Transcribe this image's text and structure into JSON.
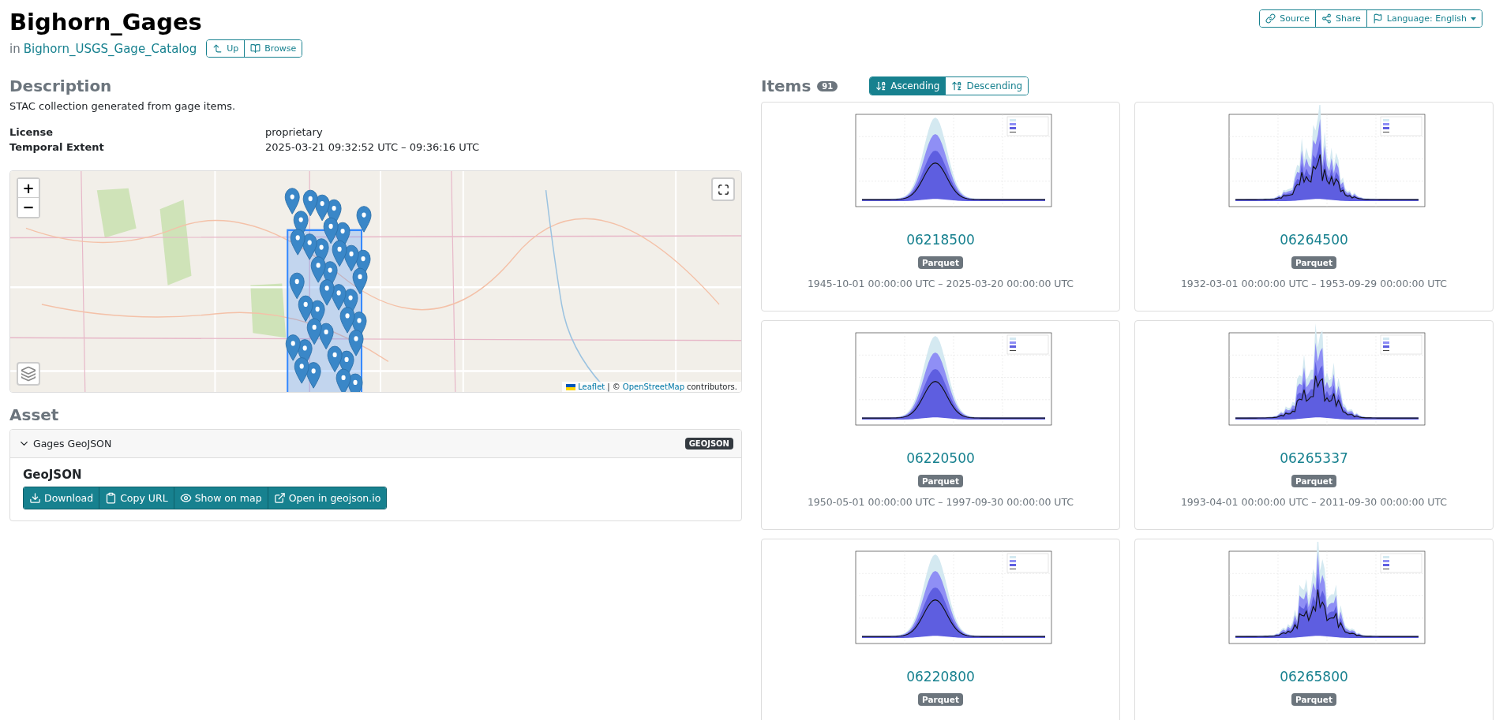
{
  "header": {
    "title": "Bighorn_Gages",
    "parent_prefix": "in",
    "parent_link": "Bighorn_USGS_Gage_Catalog",
    "nav_buttons": [
      {
        "kind": "up",
        "label": "Up"
      },
      {
        "kind": "browse",
        "label": "Browse"
      }
    ],
    "actions": [
      {
        "kind": "source",
        "label": "Source"
      },
      {
        "kind": "share",
        "label": "Share"
      },
      {
        "kind": "language",
        "label": "Language: English"
      }
    ]
  },
  "description": {
    "heading": "Description",
    "text": "STAC collection generated from gage items.",
    "metadata": [
      {
        "label": "License",
        "value": "proprietary"
      },
      {
        "label": "Temporal Extent",
        "value": "2025-03-21 09:32:52 UTC – 09:36:16 UTC"
      }
    ]
  },
  "map": {
    "zoom_in": "+",
    "zoom_out": "−",
    "attribution": {
      "leaflet": "Leaflet",
      "separator": "| ©",
      "osm": "OpenStreetMap",
      "suffix": "contributors."
    }
  },
  "asset": {
    "heading": "Asset",
    "title": "Gages GeoJSON",
    "expanded": true,
    "badge": "GEOJSON",
    "name": "GeoJSON",
    "buttons": [
      {
        "kind": "download",
        "label": "Download"
      },
      {
        "kind": "copy",
        "label": "Copy URL"
      },
      {
        "kind": "map",
        "label": "Show on map"
      },
      {
        "kind": "external",
        "label": "Open in geojson.io"
      }
    ]
  },
  "items": {
    "heading": "Items",
    "count": "91",
    "sort": [
      {
        "kind": "asc",
        "label": "Ascending",
        "selected": true
      },
      {
        "kind": "desc",
        "label": "Descending",
        "selected": false
      }
    ],
    "cards": [
      {
        "id": "06218500",
        "badge": "Parquet",
        "datetime": "1945-10-01 00:00:00 UTC – 2025-03-20 00:00:00 UTC"
      },
      {
        "id": "06264500",
        "badge": "Parquet",
        "datetime": "1932-03-01 00:00:00 UTC – 1953-09-29 00:00:00 UTC"
      },
      {
        "id": "06220500",
        "badge": "Parquet",
        "datetime": "1950-05-01 00:00:00 UTC – 1997-09-30 00:00:00 UTC"
      },
      {
        "id": "06265337",
        "badge": "Parquet",
        "datetime": "1993-04-01 00:00:00 UTC – 2011-09-30 00:00:00 UTC"
      },
      {
        "id": "06220800",
        "badge": "Parquet"
      },
      {
        "id": "06265800",
        "badge": "Parquet"
      }
    ]
  }
}
